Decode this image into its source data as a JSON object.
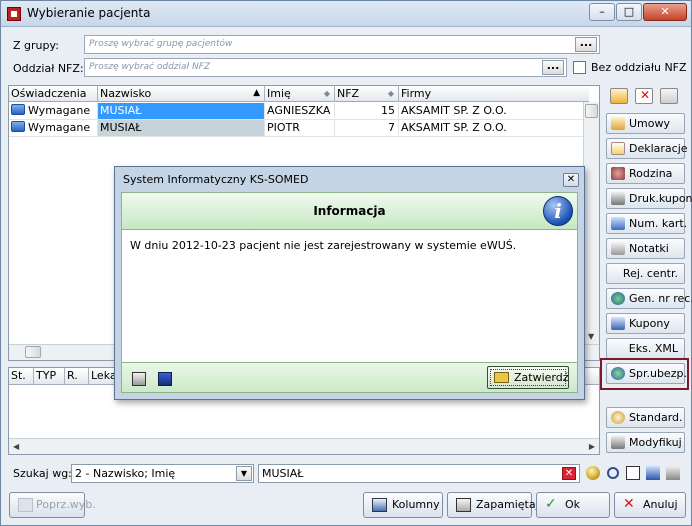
{
  "window": {
    "title": "Wybieranie pacjenta"
  },
  "filters": {
    "group_label": "Z grupy:",
    "group_placeholder": "Proszę wybrać grupę pacjentów",
    "nfz_label": "Oddział NFZ:",
    "nfz_placeholder": "Proszę wybrać oddział NFZ",
    "dots": "...",
    "no_nfz_label": "Bez oddziału NFZ"
  },
  "grid": {
    "columns": [
      "Oświadczenia",
      "Nazwisko",
      "Imię",
      "NFZ",
      "Firmy"
    ],
    "rows": [
      {
        "oswiadczenia": "Wymagane",
        "nazwisko": "MUSIAŁ",
        "imie": "AGNIESZKA",
        "nfz": "15",
        "firmy": "AKSAMIT SP. Z O.O."
      },
      {
        "oswiadczenia": "Wymagane",
        "nazwisko": "MUSIAŁ",
        "imie": "PIOTR",
        "nfz": "7",
        "firmy": "AKSAMIT SP. Z O.O."
      }
    ]
  },
  "grid2": {
    "columns": [
      "St.",
      "TYP",
      "R.",
      "Leka"
    ]
  },
  "sidebar": {
    "buttons": [
      "Umowy",
      "Deklaracje",
      "Rodzina",
      "Druk.kupon",
      "Num. kart.",
      "Notatki",
      "Rej. centr.",
      "Gen. nr rec.",
      "Kupony",
      "Eks. XML",
      "Spr.ubezp.",
      "Standard.",
      "Modyfikuj"
    ]
  },
  "search": {
    "label": "Szukaj wg:",
    "mode": "2 - Nazwisko; Imię",
    "value": "MUSIAŁ"
  },
  "bottom_buttons": {
    "prev": "Poprz.wyb.",
    "columns": "Kolumny",
    "remember": "Zapamiętaj",
    "ok": "Ok",
    "cancel": "Anuluj"
  },
  "dialog": {
    "title": "System Informatyczny KS-SOMED",
    "header": "Informacja",
    "message": "W dniu 2012-10-23 pacjent nie jest zarejestrowany w systemie eWUŚ.",
    "confirm": "Zatwierdź"
  }
}
